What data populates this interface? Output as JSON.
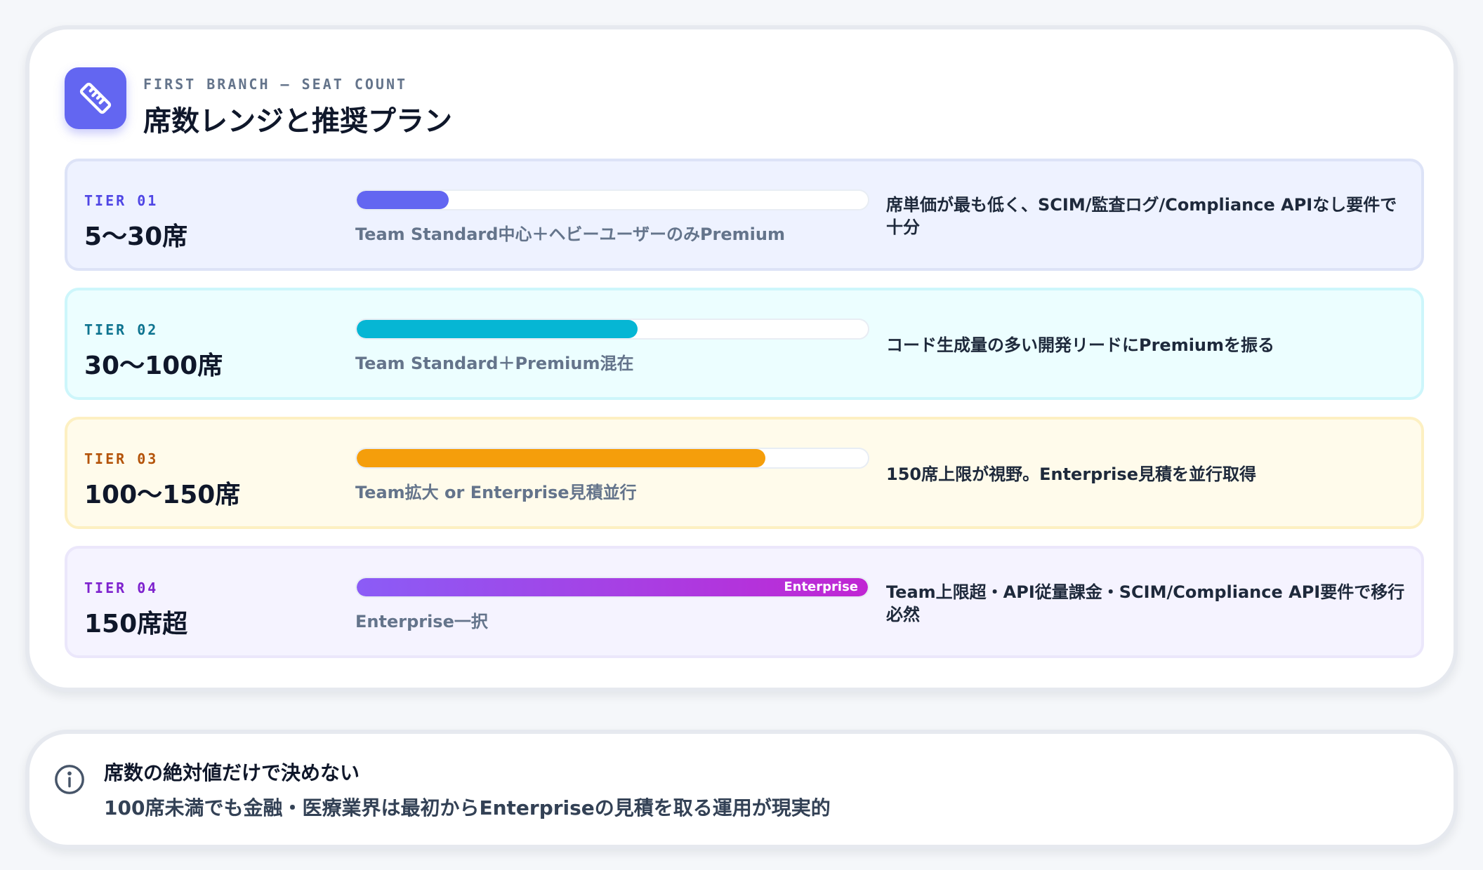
{
  "header": {
    "eyebrow": "FIRST BRANCH — SEAT COUNT",
    "title": "席数レンジと推奨プラン",
    "icon": "ruler-icon",
    "icon_color": "#6366f1"
  },
  "tiers": [
    {
      "label": "TIER 01",
      "range": "5〜30席",
      "plan": "Team Standard中心＋ヘビーユーザーのみPremium",
      "note": "席単価が最も低く、SCIM/監査ログ/Compliance APIなし要件で十分",
      "progress": 0.18,
      "accent": "#4f46e5",
      "bar_color": "#6366f1",
      "bg": "#eef2ff",
      "border": "#dde3f7"
    },
    {
      "label": "TIER 02",
      "range": "30〜100席",
      "plan": "Team Standard＋Premium混在",
      "note": "コード生成量の多い開発リードにPremiumを振る",
      "progress": 0.55,
      "accent": "#0e7490",
      "bar_color": "#06b6d4",
      "bg": "#ecfeff",
      "border": "#cdf6fb"
    },
    {
      "label": "TIER 03",
      "range": "100〜150席",
      "plan": "Team拡大 or Enterprise見積並行",
      "note": "150席上限が視野。Enterprise見積を並行取得",
      "progress": 0.8,
      "accent": "#b45309",
      "bar_color": "#f59e0b",
      "bg": "#fffbeb",
      "border": "#fdf0c2"
    },
    {
      "label": "TIER 04",
      "range": "150席超",
      "plan": "Enterprise一択",
      "note": "Team上限超・API従量課金・SCIM/Compliance API要件で移行必然",
      "progress": 1.0,
      "badge": "Enterprise",
      "accent": "#7e22ce",
      "bar_gradient": [
        "#8b5cf6",
        "#c026d3"
      ],
      "bg": "#f5f3ff",
      "border": "#ebe7fb"
    }
  ],
  "info": {
    "icon": "info-circle-icon",
    "title": "席数の絶対値だけで決めない",
    "body": "100席未満でも金融・医療業界は最初からEnterpriseの見積を取る運用が現実的"
  }
}
